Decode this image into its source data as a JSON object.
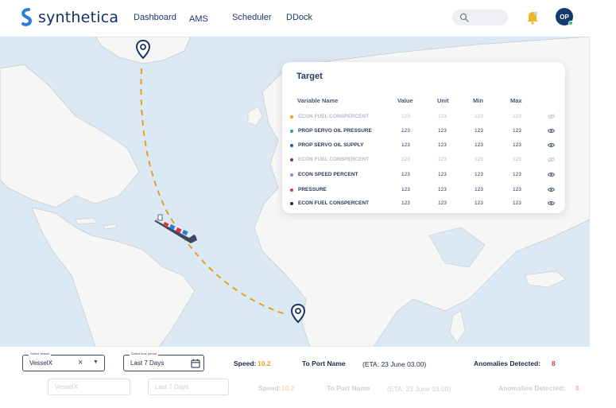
{
  "brand": {
    "name": "synthetica"
  },
  "nav": [
    {
      "label": "Dashboard"
    },
    {
      "label": "AMS"
    },
    {
      "label": "Scheduler"
    },
    {
      "label": "DDock"
    }
  ],
  "user": {
    "initials": "OP"
  },
  "icons": {
    "search": "search-icon",
    "bell": "bell-icon",
    "pin": "map-pin-icon",
    "eye": "eye-icon",
    "calendar": "calendar-icon",
    "ship": "ship-icon"
  },
  "target": {
    "title": "Target",
    "columns": [
      "Variable Name",
      "Value",
      "Unit",
      "Min",
      "Max"
    ],
    "rows": [
      {
        "name": "ECON FUEL CONSPERCENT",
        "value": "123",
        "unit": "123",
        "min": "123",
        "max": "123",
        "color": "#e3a21a",
        "muted": true
      },
      {
        "name": "PROP SERVO OIL PRESSURE",
        "value": "123",
        "unit": "123",
        "min": "123",
        "max": "123",
        "color": "#1aa6a0",
        "muted": false
      },
      {
        "name": "PROP SERVO OIL SUPPLY",
        "value": "123",
        "unit": "123",
        "min": "123",
        "max": "123",
        "color": "#1f5aa6",
        "muted": false
      },
      {
        "name": "ECON FUEL CONSPERCENT",
        "value": "123",
        "unit": "123",
        "min": "123",
        "max": "123",
        "color": "#7a2a8a",
        "muted": true
      },
      {
        "name": "ECON SPEED PERCENT",
        "value": "123",
        "unit": "123",
        "min": "123",
        "max": "123",
        "color": "#a07ed8",
        "muted": false
      },
      {
        "name": "PRESSURE",
        "value": "123",
        "unit": "123",
        "min": "123",
        "max": "123",
        "color": "#d23a5a",
        "muted": false
      },
      {
        "name": "ECON FUEL CONSPERCENT",
        "value": "123",
        "unit": "123",
        "min": "123",
        "max": "123",
        "color": "#1c2a44",
        "muted": false
      }
    ]
  },
  "bottom": {
    "vessel": {
      "label": "Select Vessel",
      "value": "VesselX"
    },
    "period": {
      "label": "Select time period",
      "value": "Last 7 Days"
    },
    "speed": {
      "label": "Speed:",
      "value": "10.2"
    },
    "port": {
      "label": "To Port Name"
    },
    "eta": {
      "label": "(ETA: 23 June 03.00)"
    },
    "anomalies": {
      "label": "Anomalies Detected:",
      "value": "8"
    }
  },
  "colors": {
    "brand": "#123066",
    "accent": "#e3a21a",
    "alert": "#d23a3a",
    "sea": "#dbe9f5",
    "land": "#f6f6f4"
  }
}
